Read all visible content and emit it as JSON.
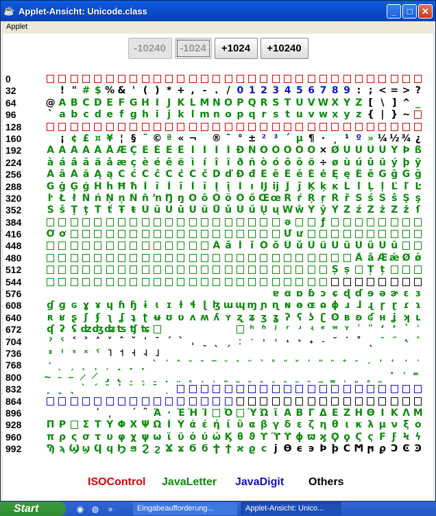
{
  "window": {
    "title": "Applet-Ansicht: Unicode.class",
    "menu": "Applet",
    "buttons": {
      "minimize": "_",
      "maximize": "□",
      "close": "✕"
    }
  },
  "toolbar": {
    "minus10240": "-10240",
    "minus1024": "-1024",
    "plus1024": "+1024",
    "plus10240": "+10240"
  },
  "legend": {
    "iso": "ISOControl",
    "letter": "JavaLetter",
    "digit": "JavaDigit",
    "other": "Others"
  },
  "colors": {
    "iso": "#d80000",
    "letter": "#0a8a0a",
    "digit": "#1010c8",
    "other": "#000000"
  },
  "rows": [
    {
      "start": "0",
      "cells": "IIIIIIIIIIIIIIIIIIIIIIIIIIIIIIII",
      "chars": ""
    },
    {
      "start": "32",
      "cells": "OOOLLOOOOOOOOOOODDDDDDDDDDOOOOOO",
      "chars": " !\"#$%&'()*+,-./0123456789:;<=>?"
    },
    {
      "start": "64",
      "cells": "OLLLLLLLLLLLLLLLLLLLLLLLLLLOOOOL",
      "chars": "@ABCDEFGHIJKLMNOPQRSTUVWXYZ[\\]^_"
    },
    {
      "start": "96",
      "cells": "OLLLLLLLLLLLLLLLLLLLLLLLLLLOOOOI",
      "chars": "`abcdefghijklmnopqrstuvwxyz{|}~ "
    },
    {
      "start": "128",
      "cells": "IIIIIIIIIIIIIIIIIIIIIIIIIIIIIIII",
      "chars": ""
    },
    {
      "start": "160",
      "cells": "OOLLLLOOOOLOODOOOODDOLOOOODLOOOO",
      "chars": " ¡¢£¤¥¦§¨©ª«¬­®¯°±²³´µ¶·¸¹º»¼½¾¿"
    },
    {
      "start": "192",
      "cells": "LLLLLLLLLLLLLLLLLLLLLLLOLLLLLLLL",
      "chars": "ÀÁÂÃÄÅÆÇÈÉÊËÌÍÎÏÐÑÒÓÔÕÖ×ØÙÚÛÜÝÞß"
    },
    {
      "start": "224",
      "cells": "LLLLLLLLLLLLLLLLLLLLLLLOLLLLLLLL",
      "chars": "àáâãäåæçèéêëìíîïðñòóôõö÷øùúûüýþÿ"
    },
    {
      "start": "256",
      "cells": "LLLLLLLLLLLLLLLLLLLLLLLLLLLLLLLL",
      "chars": "ĀāĂăĄąĆćĈĉĊċČčĎďĐđĒēĔĕĖėĘęĚěĜĝĞğ"
    },
    {
      "start": "288",
      "cells": "LLLLLLLLLLLLLLLLLLLLLLLLLLLLLLLL",
      "chars": "ĠġĢģĤĥĦħĨĩĪīĬĭĮįİıĲĳĴĵĶķĸĹĺĻļĽľĿ"
    },
    {
      "start": "320",
      "cells": "LLLLLLLLLLLLLLLLLLLLLLLLLLLLLLLL",
      "chars": "ŀŁłŃńŅņŇňŉŊŋŌōŎŏŐőŒœŔŕŖŗŘřŚśŜŝŞş"
    },
    {
      "start": "352",
      "cells": "LLLLLLLLLLLLLLLLLLLLLLLLLLLLLLLL",
      "chars": "ŠšŢţŤťŦŧŨũŪūŬŭŮůŰűŲųŴŵŶŷŸŹźŻżŽžſ"
    },
    {
      "start": "384",
      "cells": "LLLLLLLLLLLLLLLLLLLLLLLLLLLLLLLL",
      "chars": "                    ǝ  ƒ        "
    },
    {
      "start": "416",
      "cells": "LLLLLLLLLLLLLLLLLLLLLLLLLLLLLLLL",
      "chars": "Ơơ                  Ưư          "
    },
    {
      "start": "448",
      "cells": "LLLLLLLLLLLLLLLLLLLLLLLLLLLLLLLL",
      "chars": "              ǍǎǏǐǑǒǓǔǕǖǗǘǙǚǛǜ    "
    },
    {
      "start": "480",
      "cells": "LLLLLLLLLLLLLLLLLLLLLLLLLLLLLLLL",
      "chars": "                          ǺǻǼǽǾǿ"
    },
    {
      "start": "512",
      "cells": "LLLLLLLLLLLLLLLLLLLLLLLLLLLLLLLL",
      "chars": "                        Șș Țț   "
    },
    {
      "start": "544",
      "cells": "LLLLLLLLLLLLLLLLLLLLLLLLOOOOOOOO",
      "chars": ""
    },
    {
      "start": "576",
      "cells": "OOOOOOOOOOOOOOOOOOOLLLLLLLLLLLLL",
      "chars": "                   ɐɑɒɓɔɕɖɗɘəɚɛɜ"
    },
    {
      "start": "608",
      "cells": "LLLLLLLLLLLLLLLLLLLLLLLLLLLLLLLL",
      "chars": "ɠɡɢɣɤɥɦɧɨɩɪɫɬɭɮɯɰɱɲɳɴɵɶɷɸɹɺɻɼɽɾɿ"
    },
    {
      "start": "640",
      "cells": "LLLLLLLLLLLLLLLLLLLLLLLLLLLLLLLL",
      "chars": "ʀʁʂʃʄʅʆʇʈʉʊʋʌʍʎʏʐʑʒʓʔʕʖʗʘʙʚʛʜʝʞʟ"
    },
    {
      "start": "672",
      "cells": "LLLLLLLLLLOOOOOOLLLLLLLLLLLLLLLL",
      "chars": "ʠʡʢʣʤʥʦʧʨ        ʰʱʲʳʴʵʶʷʸʹʺʻʼʽʾʿ"
    },
    {
      "start": "704",
      "cells": "LLOOOOOOOOOOOOOOLLOOOOOOOOOOLLLL",
      "chars": "ˀˁ˂˃˄˅ˆˇˈˉˊˋˌˍˎˏːˑ˒˓˔˕˖˗˘˙˚˛˜˝˞˟"
    },
    {
      "start": "736",
      "cells": "LLLLLOOOOOOOOOOOOOOOOOOOOOOOOOOO",
      "chars": "ˠˡˢˣˤ˥˦˧˨˩                      "
    },
    {
      "start": "768",
      "cells": "LLLLLLLLLLLLLLLLLLLLLLLLLLLLLLLL",
      "chars": "̛̖̗̘̙̜̝̞̟̀́̂̃̄̅̆̇̈̉̊̋̌̍̎̏̐̑̒̓̔̕̚"
    },
    {
      "start": "800",
      "cells": "LLLLLLLLLLLLLLLLLLLLLLLLLLLLLLLL",
      "chars": "̴̵̶̷̸̡̢̧̨̠̣̤̥̦̩̪̫̬̭̮̯̰̱̲̳̹̺̻̼̽̾̿"
    },
    {
      "start": "832",
      "cells": "LLLLLLLLLLDDDDDDDDDDDDDDDDDDDDDD",
      "chars": "͇͈͉̀́͂̓̈́͆ͅ                      "
    },
    {
      "start": "864",
      "cells": "DDDDDDDDDDDDDDDDOOOOOOOOOOOOOOOO",
      "chars": ""
    },
    {
      "start": "896",
      "cells": "OOOOOOOOOLLLLLLLLLLLLLLLLLLLLLLL",
      "chars": "    ʹ͵ ΄΅Ά·ΈΉΊ Ό ΎΏΐΑΒΓΔΕΖΗΘΙΚΛΜΝΞΟ"
    },
    {
      "start": "928",
      "cells": "LLLLLLLLLLLLLLLLLLLLLLLLLLLLLLLL",
      "chars": "ΠΡ ΣΤΥΦΧΨΩΪΫάέήίΰαβγδεζηθικλμνξο"
    },
    {
      "start": "960",
      "cells": "LLLLLLLLLLLLLLLLLLLLLLLLLLLLLLLL",
      "chars": "πρςστυφχψωϊϋόύώϏϐϑϒϓϔϕϖϗϘϙϚϛϜϝϞϟ"
    },
    {
      "start": "992",
      "cells": "LLLLLLLLLLLLLLLLLLLOOOOOOOOOOOOO",
      "chars": "ϠϡϢϣϤϥϦϧϨϩϪϫϬϭϮϯϰϱϲϳϴϵ϶ϷϸϹϺϻϼϽϾϿ"
    }
  ],
  "taskbar": {
    "start": "Start",
    "task1": "Eingabeaufforderung...",
    "task2": "Applet-Ansicht: Unico..."
  }
}
